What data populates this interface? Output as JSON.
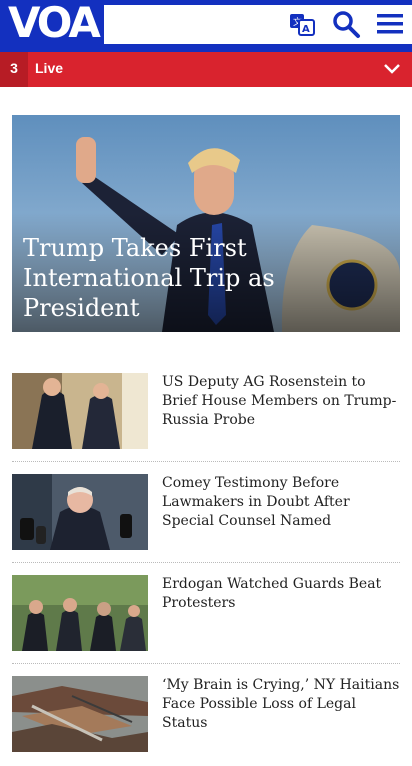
{
  "header": {
    "logo_text": "VOA",
    "icons": [
      "language-icon",
      "search-icon",
      "menu-icon"
    ]
  },
  "live": {
    "count": "3",
    "label": "Live"
  },
  "hero": {
    "title": "Trump Takes First International Trip as President"
  },
  "stories": [
    {
      "title": "US Deputy AG Rosenstein to Brief House Members on Trump-Russia Probe"
    },
    {
      "title": "Comey Testimony Before Lawmakers in Doubt After Special Counsel Named"
    },
    {
      "title": "Erdogan Watched Guards Beat Protesters"
    },
    {
      "title": "‘My Brain is Crying,’ NY Haitians Face Possible Loss of Legal Status"
    }
  ],
  "colors": {
    "brand_blue": "#1330bf",
    "live_red": "#d9232e"
  }
}
